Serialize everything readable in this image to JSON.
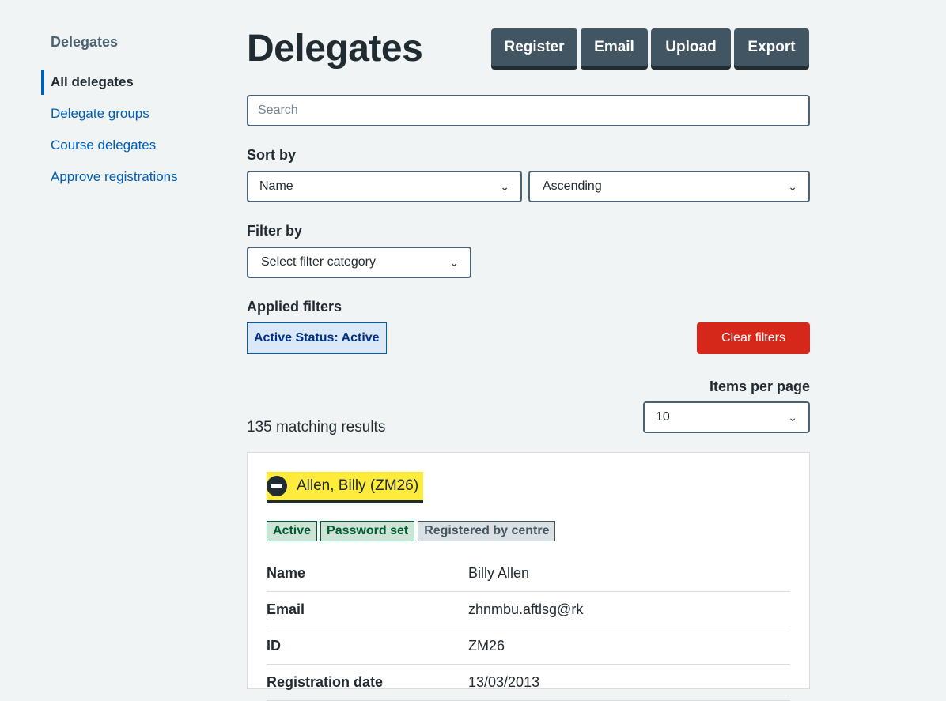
{
  "sidebar": {
    "title": "Delegates",
    "items": [
      {
        "label": "All delegates",
        "active": true
      },
      {
        "label": "Delegate groups",
        "active": false
      },
      {
        "label": "Course delegates",
        "active": false
      },
      {
        "label": "Approve registrations",
        "active": false
      }
    ]
  },
  "page": {
    "title": "Delegates",
    "actions": {
      "register": "Register",
      "email": "Email",
      "upload": "Upload",
      "export": "Export"
    }
  },
  "search": {
    "placeholder": "Search",
    "value": ""
  },
  "sort": {
    "label": "Sort by",
    "field": "Name",
    "direction": "Ascending"
  },
  "filter": {
    "label": "Filter by",
    "category": "Select filter category"
  },
  "applied_filters": {
    "label": "Applied filters",
    "tag": "Active Status: Active",
    "clear": "Clear filters"
  },
  "pagination": {
    "items_per_page_label": "Items per page",
    "items_per_page": "10"
  },
  "results": {
    "count_text": "135 matching results"
  },
  "delegate": {
    "heading": "Allen, Billy (ZM26)",
    "tags": [
      "Active",
      "Password set",
      "Registered by centre"
    ],
    "details": [
      {
        "key": "Name",
        "value": "Billy Allen"
      },
      {
        "key": "Email",
        "value": "zhnmbu.aftlsg@rk"
      },
      {
        "key": "ID",
        "value": "ZM26"
      },
      {
        "key": "Registration date",
        "value": "13/03/2013"
      }
    ]
  },
  "colors": {
    "background": "#f0f4f5",
    "link": "#005eb8",
    "button": "#425563",
    "danger": "#d5281b",
    "highlight": "#ffeb3b"
  }
}
